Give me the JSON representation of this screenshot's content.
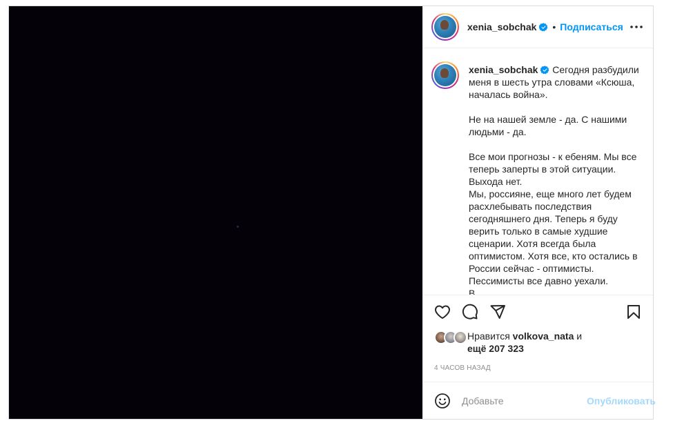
{
  "post": {
    "author": {
      "username": "xenia_sobchak",
      "verified": true,
      "avatar": "profile-photo"
    },
    "header": {
      "separator": "•",
      "follow_label": "Подписаться",
      "more_icon": "more-horizontal-icon"
    },
    "caption": {
      "username": "xenia_sobchak",
      "paragraphs": [
        "Сегодня разбудили меня в шесть утра словами «Ксюша, началась война».",
        "",
        "Не на нашей земле - да. С нашими людьми - да.",
        "",
        "Все мои прогнозы - к ебеням. Мы все теперь заперты в этой ситуации. Выхода нет.",
        "Мы, россияне, еще много лет будем расхлебывать последствия сегодняшнего дня. Теперь я буду верить только в самые худшие сценарии. Хотя всегда была оптимистом. Хотя все, кто остались в России сейчас - оптимисты. Пессимисты все давно уехали.",
        "В"
      ]
    },
    "actions": {
      "icons": [
        "heart-icon",
        "comment-icon",
        "share-icon",
        "bookmark-icon"
      ]
    },
    "likes": {
      "prefix": "Нравится",
      "user": "volkova_nata",
      "conjunction": "и",
      "more_prefix": "ещё",
      "count": "207 323"
    },
    "timestamp": "4 часов назад",
    "comment": {
      "emoji_icon": "emoji-icon",
      "placeholder": "Добавьте",
      "value": "",
      "publish_label": "Опубликовать"
    }
  },
  "colors": {
    "accent": "#0095f6",
    "text": "#262626",
    "muted": "#8e8e8e",
    "border": "#dbdbdb",
    "media_bg": "#040208"
  }
}
